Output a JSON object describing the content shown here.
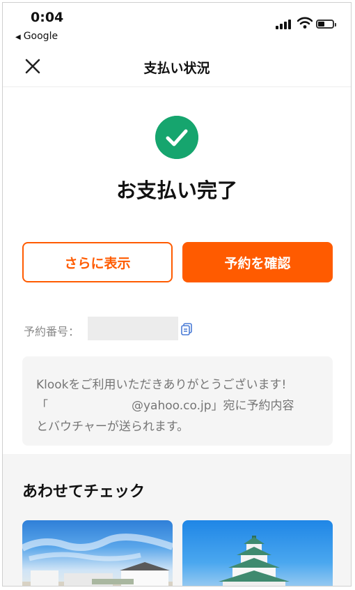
{
  "status_bar": {
    "time": "0:04",
    "back_app": "Google"
  },
  "nav": {
    "title": "支払い状況"
  },
  "success": {
    "heading": "お支払い完了"
  },
  "buttons": {
    "more": "さらに表示",
    "confirm": "予約を確認"
  },
  "booking": {
    "label": "予約番号："
  },
  "message": {
    "line1": "Klookをご利用いただきありがとうございます!",
    "open_quote": "「",
    "email": "@yahoo.co.jp",
    "line2_rest": "」宛に予約内容",
    "line3": "とバウチャーが送られます。"
  },
  "section": {
    "title": "あわせてチェック"
  },
  "colors": {
    "accent": "#ff5b00",
    "success": "#16a56e"
  }
}
